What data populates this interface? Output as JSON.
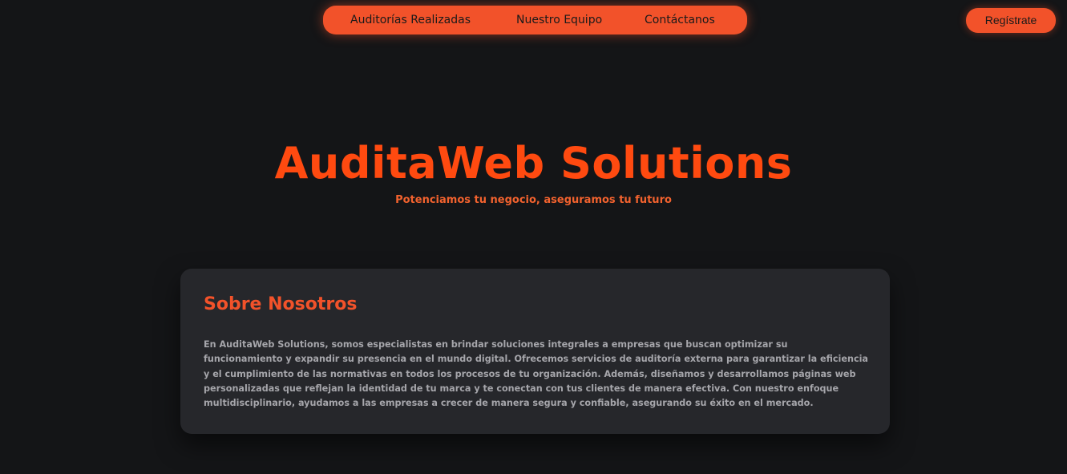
{
  "nav": {
    "items": [
      {
        "label": "Auditorías Realizadas"
      },
      {
        "label": "Nuestro Equipo"
      },
      {
        "label": "Contáctanos"
      }
    ]
  },
  "header": {
    "register_label": "Regístrate"
  },
  "hero": {
    "title": "AuditaWeb Solutions",
    "subtitle": "Potenciamos tu negocio, aseguramos tu futuro"
  },
  "about": {
    "title": "Sobre Nosotros",
    "body": "En AuditaWeb Solutions, somos especialistas en brindar soluciones integrales a empresas que buscan optimizar su funcionamiento y expandir su presencia en el mundo digital. Ofrecemos servicios de auditoría externa para garantizar la eficiencia y el cumplimiento de las normativas en todos los procesos de tu organización. Además, diseñamos y desarrollamos páginas web personalizadas que reflejan la identidad de tu marca y te conectan con tus clientes de manera efectiva. Con nuestro enfoque multidisciplinario, ayudamos a las empresas a crecer de manera segura y confiable, asegurando su éxito en el mercado."
  },
  "colors": {
    "background": "#141517",
    "accent": "#f2522a",
    "title": "#ff4a10",
    "card": "#26272b",
    "body_text": "#a6a6ab"
  }
}
